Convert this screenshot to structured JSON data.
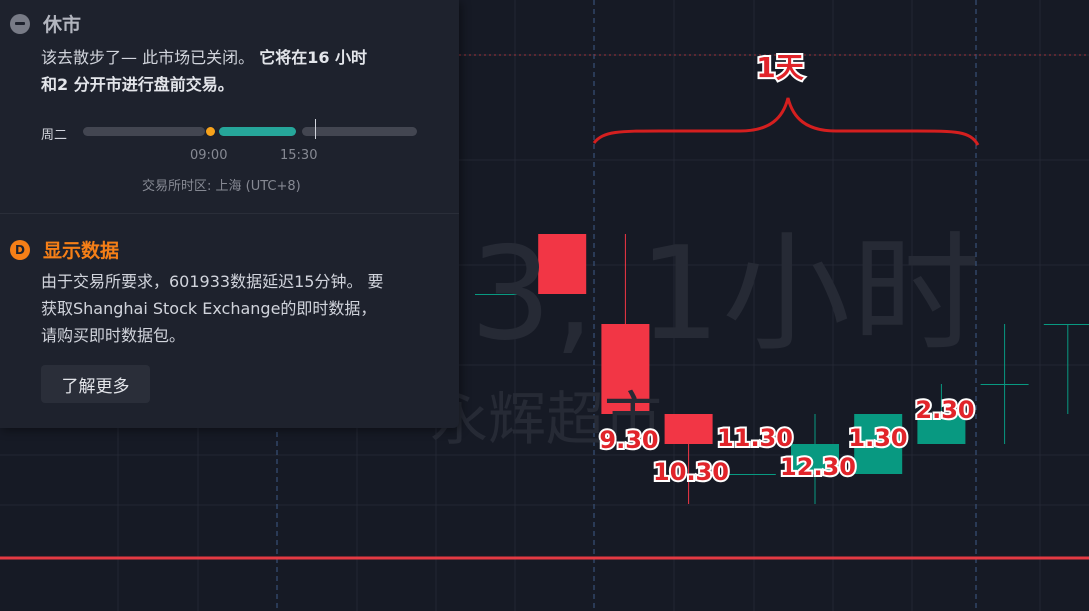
{
  "watermark": {
    "symbol_interval": "3, 1小时",
    "name": "永辉超市"
  },
  "market_status": {
    "title": "休市",
    "message_plain": "该去散步了— 此市场已关闭。",
    "message_bold_1": "它将在16 小时",
    "message_bold_2": "和2 分开市进行盘前交易。",
    "day_label": "周二",
    "session_start": "09:00",
    "session_end": "15:30",
    "timezone": "交易所时区: 上海 (UTC+8)"
  },
  "data_notice": {
    "icon_letter": "D",
    "title": "显示数据",
    "line1": "由于交易所要求，601933数据延迟15分钟。 要",
    "line2": "获取Shanghai Stock Exchange的即时数据，",
    "line3": "请购买即时数据包。",
    "learn_more": "了解更多"
  },
  "annotations": {
    "brace_label": "1天",
    "candle_labels": [
      "9.30",
      "10.30",
      "11.30",
      "12.30",
      "1.30",
      "2.30"
    ]
  },
  "colors": {
    "up": "#089981",
    "down": "#f23645",
    "annotation": "#e1242a",
    "background": "#161a25"
  },
  "candles": [
    {
      "open": 3.92,
      "high": 3.92,
      "low": 3.92,
      "close": 3.92
    },
    {
      "open": 4.12,
      "high": 4.12,
      "low": 3.92,
      "close": 3.92
    },
    {
      "open": 3.82,
      "high": 4.12,
      "low": 3.52,
      "close": 3.52
    },
    {
      "open": 3.52,
      "high": 3.52,
      "low": 3.22,
      "close": 3.42
    },
    {
      "open": 3.32,
      "high": 3.32,
      "low": 3.32,
      "close": 3.32
    },
    {
      "open": 3.32,
      "high": 3.52,
      "low": 3.22,
      "close": 3.42
    },
    {
      "open": 3.32,
      "high": 3.52,
      "low": 3.32,
      "close": 3.52
    },
    {
      "open": 3.42,
      "high": 3.62,
      "low": 3.42,
      "close": 3.52
    },
    {
      "open": 3.62,
      "high": 3.82,
      "low": 3.42,
      "close": 3.62
    },
    {
      "open": 3.82,
      "high": 3.82,
      "low": 3.52,
      "close": 3.82
    }
  ]
}
